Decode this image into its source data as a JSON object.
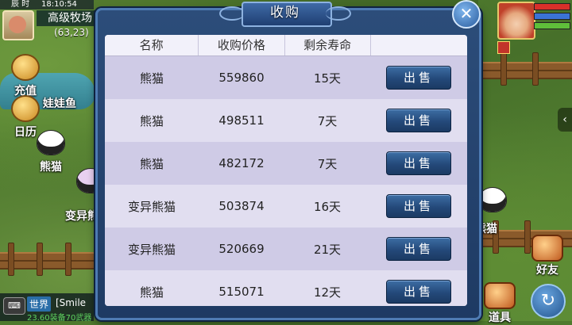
{
  "player": {
    "shichen": "辰 时",
    "clock": "18:10:54",
    "ranch_name": "高级牧场",
    "coords": "(63,23)"
  },
  "side_buttons": [
    {
      "label": "充值",
      "icon": "gift-chest-icon"
    },
    {
      "label": "娃娃鱼",
      "icon": "fish-icon"
    },
    {
      "label": "日历",
      "icon": "calendar-icon"
    }
  ],
  "pets": {
    "left_panda_label": "熊猫",
    "left_mutant_label": "变异熊",
    "right_panda_label": "熊猫"
  },
  "top_right": {
    "portrait_icon": "hero-portrait-icon",
    "hp_color": "#d8302a",
    "mp_color": "#3b73d6",
    "exp_color": "#5fbf3a"
  },
  "chat": {
    "icon": "keyboard-icon",
    "channel": "世界",
    "message": "[Smile",
    "sub": "23.60装备70武器"
  },
  "bottom_right": {
    "friends_label": "好友",
    "items_label": "道具",
    "refresh_icon": "refresh-icon"
  },
  "dialog": {
    "title": "收购",
    "close_icon": "close-icon",
    "columns": [
      "名称",
      "收购价格",
      "剩余寿命",
      ""
    ],
    "rows": [
      {
        "name": "熊猫",
        "price": "559860",
        "life": "15天",
        "action": "出售"
      },
      {
        "name": "熊猫",
        "price": "498511",
        "life": "7天",
        "action": "出售"
      },
      {
        "name": "熊猫",
        "price": "482172",
        "life": "7天",
        "action": "出售"
      },
      {
        "name": "变异熊猫",
        "price": "503874",
        "life": "16天",
        "action": "出售"
      },
      {
        "name": "变异熊猫",
        "price": "520669",
        "life": "21天",
        "action": "出售"
      },
      {
        "name": "熊猫",
        "price": "515071",
        "life": "12天",
        "action": "出售"
      }
    ]
  }
}
